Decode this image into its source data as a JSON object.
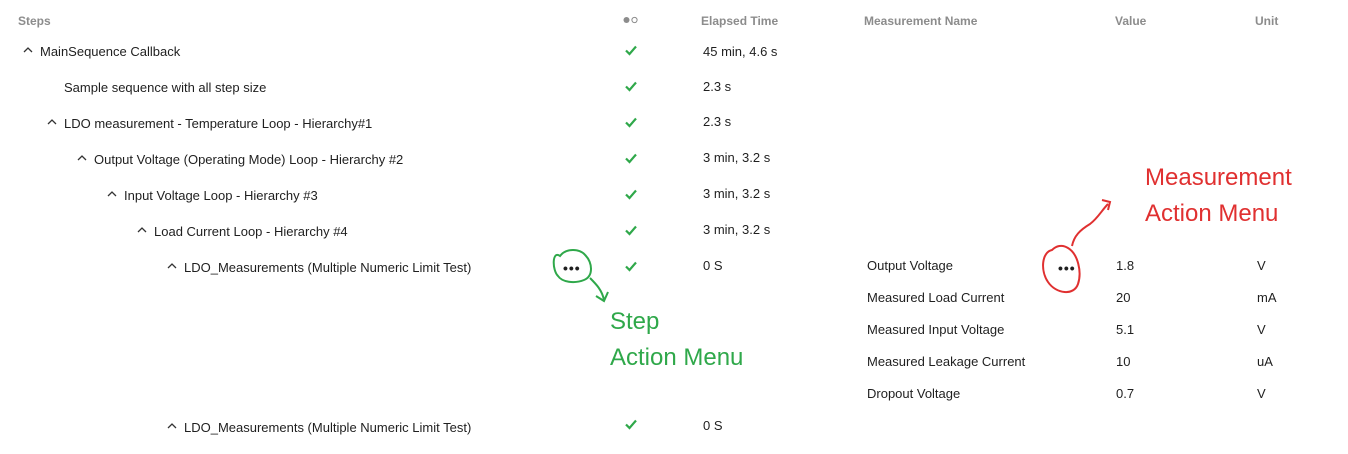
{
  "header": {
    "steps": "Steps",
    "elapsed_time": "Elapsed Time",
    "measurement_name": "Measurement Name",
    "value": "Value",
    "unit": "Unit",
    "status_icon": "status-dots-icon"
  },
  "steps": [
    {
      "label": "MainSequence Callback",
      "expandable": true,
      "elapsed": "45 min, 4.6 s"
    },
    {
      "label": "Sample sequence with all step size",
      "expandable": false,
      "elapsed": "2.3 s"
    },
    {
      "label": "LDO measurement - Temperature Loop - Hierarchy#1",
      "expandable": true,
      "elapsed": "2.3 s"
    },
    {
      "label": "Output Voltage (Operating Mode) Loop - Hierarchy #2",
      "expandable": true,
      "elapsed": "3 min, 3.2 s"
    },
    {
      "label": "Input Voltage Loop - Hierarchy #3",
      "expandable": true,
      "elapsed": "3 min, 3.2 s"
    },
    {
      "label": "Load Current Loop - Hierarchy #4",
      "expandable": true,
      "elapsed": "3 min, 3.2 s"
    },
    {
      "label": "LDO_Measurements (Multiple Numeric Limit Test)",
      "expandable": true,
      "elapsed": "0 S",
      "action_menu": "•••"
    },
    {
      "label": "LDO_Measurements (Multiple Numeric Limit Test)",
      "expandable": true,
      "elapsed": "0 S"
    }
  ],
  "measurements": [
    {
      "name": "Output Voltage",
      "value": "1.8",
      "unit": "V",
      "action_menu": "•••"
    },
    {
      "name": "Measured Load Current",
      "value": "20",
      "unit": "mA"
    },
    {
      "name": "Measured Input Voltage",
      "value": "5.1",
      "unit": "V"
    },
    {
      "name": "Measured Leakage Current",
      "value": "10",
      "unit": "uA"
    },
    {
      "name": "Dropout Voltage",
      "value": "0.7",
      "unit": "V"
    }
  ],
  "annotations": {
    "step_line1": "Step",
    "step_line2": "Action Menu",
    "measurement_line1": "Measurement",
    "measurement_line2": "Action Menu"
  },
  "colors": {
    "check": "#2fa84a",
    "annotation_green": "#2fa84a",
    "annotation_red": "#e03030",
    "header_text": "#8c8c8c"
  }
}
